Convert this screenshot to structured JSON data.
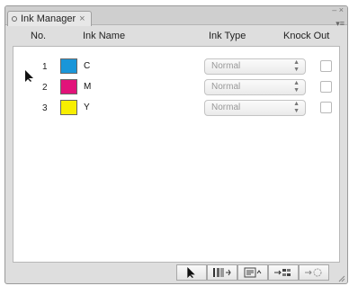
{
  "panel": {
    "tab_label": "Ink Manager",
    "tab_close": "×",
    "window_close": "×",
    "window_minimize": "–"
  },
  "headers": {
    "no": "No.",
    "ink_name": "Ink Name",
    "ink_type": "Ink Type",
    "knock_out": "Knock Out"
  },
  "inks": [
    {
      "no": "1",
      "name": "C",
      "color": "#1a96d9",
      "ink_type": "Normal",
      "knock_out": false
    },
    {
      "no": "2",
      "name": "M",
      "color": "#e2137a",
      "ink_type": "Normal",
      "knock_out": false
    },
    {
      "no": "3",
      "name": "Y",
      "color": "#f7ee00",
      "ink_type": "Normal",
      "knock_out": false
    }
  ],
  "toolbar": {
    "icons": [
      "select-arrow-icon",
      "new-ink-icon",
      "edit-ink-icon",
      "move-ink-icon",
      "delete-ink-icon"
    ]
  }
}
